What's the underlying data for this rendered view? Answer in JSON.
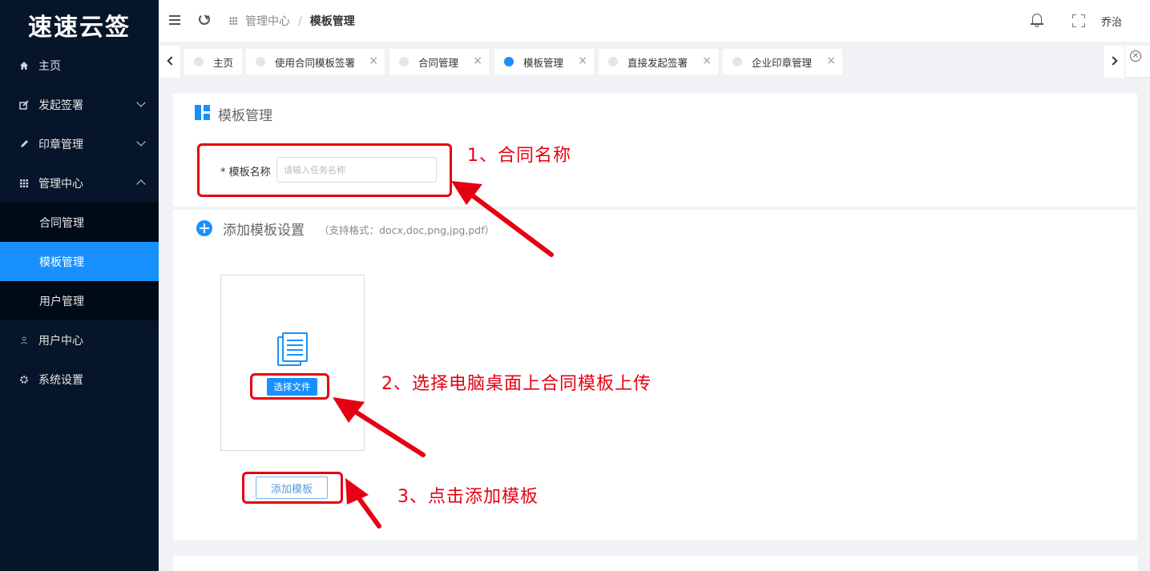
{
  "app": {
    "logo": "速速云签",
    "user": "乔治"
  },
  "sidebar": {
    "items": [
      {
        "label": "主页"
      },
      {
        "label": "发起签署"
      },
      {
        "label": "印章管理"
      },
      {
        "label": "管理中心"
      },
      {
        "label": "合同管理"
      },
      {
        "label": "模板管理"
      },
      {
        "label": "用户管理"
      },
      {
        "label": "用户中心"
      },
      {
        "label": "系统设置"
      }
    ]
  },
  "breadcrumb": {
    "parent": "管理中心",
    "separator": "/",
    "current": "模板管理"
  },
  "tabs": [
    {
      "label": "主页"
    },
    {
      "label": "使用合同模板签署"
    },
    {
      "label": "合同管理"
    },
    {
      "label": "模板管理"
    },
    {
      "label": "直接发起签署"
    },
    {
      "label": "企业印章管理"
    }
  ],
  "tab_close_glyph": "×",
  "form": {
    "section_title": "模板管理",
    "name_label": "* 模板名称",
    "name_placeholder": "请输入任务名称",
    "add_section_title": "添加模板设置",
    "add_hint": "（支持格式：docx,doc,png,jpg,pdf）",
    "choose_file": "选择文件",
    "add_template": "添加模板"
  },
  "annotations": {
    "a1": "1、合同名称",
    "a2": "2、选择电脑桌面上合同模板上传",
    "a3": "3、点击添加模板"
  },
  "colors": {
    "sidebar_bg": "#061529",
    "accent": "#1890ff",
    "annotation": "#e60012"
  }
}
